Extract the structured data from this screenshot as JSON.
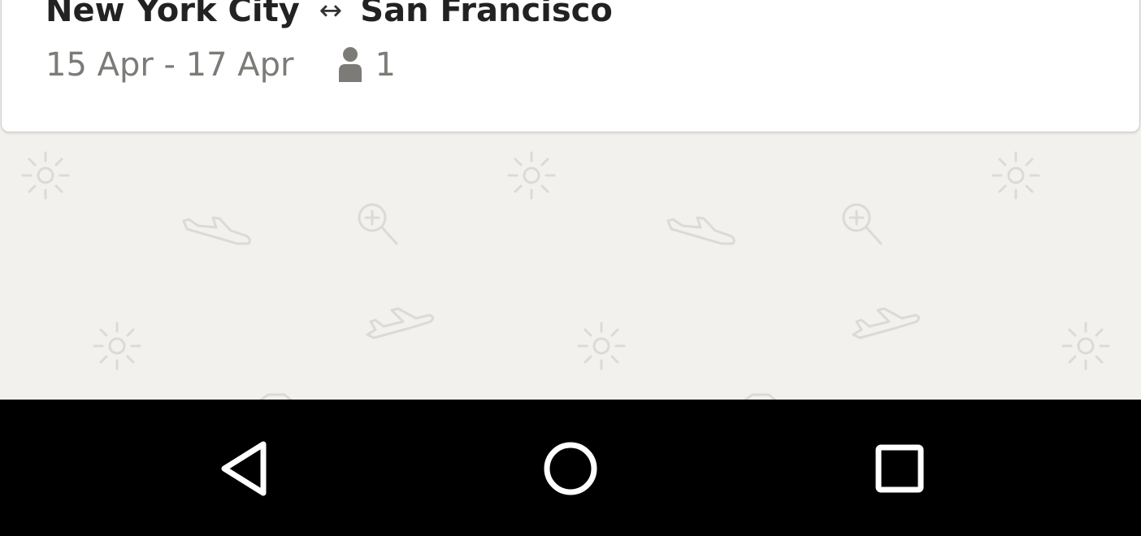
{
  "trip": {
    "origin": "New York City",
    "arrow": "↔",
    "destination": "San Francisco",
    "dates": "15 Apr - 17 Apr",
    "passenger_icon": "person-icon",
    "passengers": "1"
  },
  "background": {
    "icons": [
      "sun-icon",
      "plane-icon",
      "zoom-in-icon"
    ],
    "pattern_color": "#dcdad6",
    "color": "#f2f1ee"
  },
  "nav_bar": {
    "buttons": [
      "back-icon",
      "home-icon",
      "recents-icon"
    ],
    "color": "#000000"
  }
}
